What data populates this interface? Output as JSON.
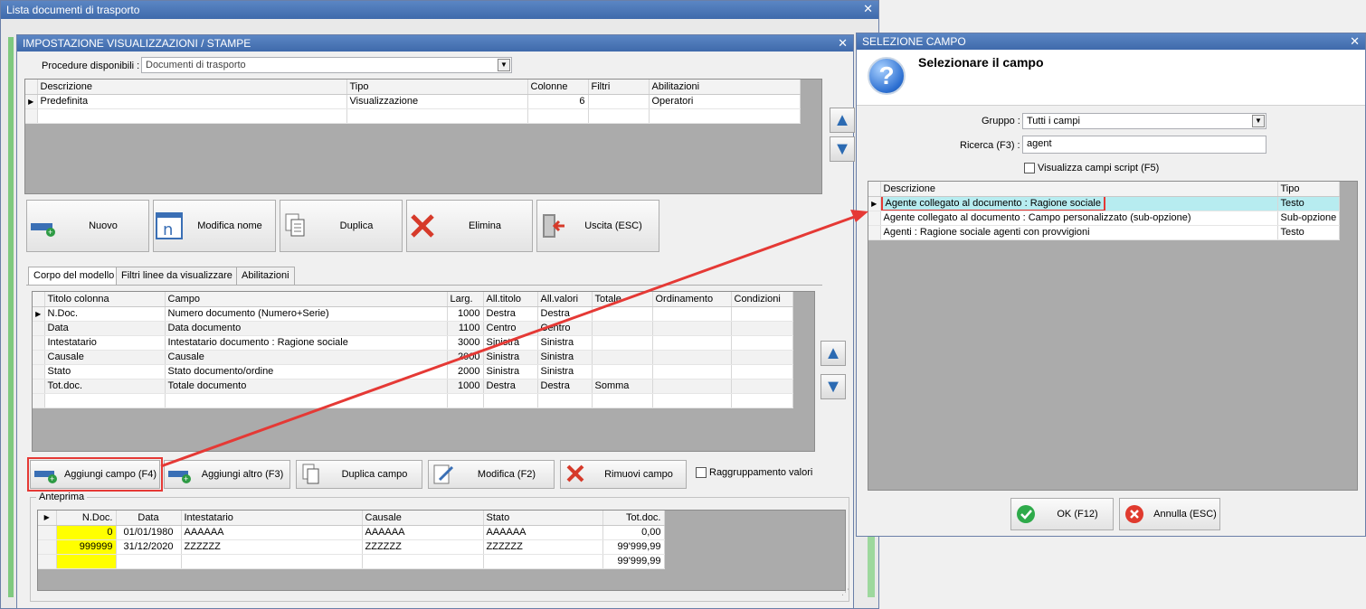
{
  "back_window": {
    "title": "Lista documenti di trasporto"
  },
  "impostazione": {
    "title": "IMPOSTAZIONE VISUALIZZAZIONI / STAMPE",
    "procedure_label": "Procedure disponibili :",
    "procedure_value": "Documenti di trasporto",
    "layouts_grid": {
      "headers": [
        "Descrizione",
        "Tipo",
        "Colonne",
        "Filtri",
        "Abilitazioni"
      ],
      "rows": [
        [
          "Predefinita",
          "Visualizzazione",
          "6",
          "",
          "Operatori"
        ]
      ]
    },
    "toolbar": {
      "nuovo": "Nuovo",
      "modifica_nome": "Modifica nome",
      "duplica": "Duplica",
      "elimina": "Elimina",
      "uscita": "Uscita (ESC)"
    },
    "tabs": [
      "Corpo del modello",
      "Filtri linee da visualizzare",
      "Abilitazioni"
    ],
    "columns_grid": {
      "headers": [
        "Titolo colonna",
        "Campo",
        "Larg.",
        "All.titolo",
        "All.valori",
        "Totale",
        "Ordinamento",
        "Condizioni"
      ],
      "rows": [
        [
          "N.Doc.",
          "Numero documento (Numero+Serie)",
          "1000",
          "Destra",
          "Destra",
          "",
          "",
          ""
        ],
        [
          "Data",
          "Data documento",
          "1100",
          "Centro",
          "Centro",
          "",
          "",
          ""
        ],
        [
          "Intestatario",
          "Intestatario documento : Ragione sociale",
          "3000",
          "Sinistra",
          "Sinistra",
          "",
          "",
          ""
        ],
        [
          "Causale",
          "Causale",
          "2000",
          "Sinistra",
          "Sinistra",
          "",
          "",
          ""
        ],
        [
          "Stato",
          "Stato documento/ordine",
          "2000",
          "Sinistra",
          "Sinistra",
          "",
          "",
          ""
        ],
        [
          "Tot.doc.",
          "Totale documento",
          "1000",
          "Destra",
          "Destra",
          "Somma",
          "",
          ""
        ]
      ]
    },
    "actions": {
      "aggiungi_campo": "Aggiungi campo (F4)",
      "aggiungi_altro": "Aggiungi altro (F3)",
      "duplica_campo": "Duplica campo",
      "modifica": "Modifica (F2)",
      "rimuovi": "Rimuovi campo",
      "raggruppamento": "Raggruppamento valori"
    },
    "anteprima": {
      "label": "Anteprima",
      "headers": [
        "N.Doc.",
        "Data",
        "Intestatario",
        "Causale",
        "Stato",
        "Tot.doc."
      ],
      "rows": [
        [
          "0",
          "01/01/1980",
          "AAAAAA",
          "AAAAAA",
          "AAAAAA",
          "0,00"
        ],
        [
          "999999",
          "31/12/2020",
          "ZZZZZZ",
          "ZZZZZZ",
          "ZZZZZZ",
          "99'999,99"
        ],
        [
          "",
          "",
          "",
          "",
          "",
          "99'999,99"
        ]
      ]
    }
  },
  "selezione": {
    "title": "SELEZIONE CAMPO",
    "heading": "Selezionare il campo",
    "gruppo_label": "Gruppo :",
    "gruppo_value": "Tutti i campi",
    "ricerca_label": "Ricerca (F3) :",
    "ricerca_value": "agent",
    "script_label": "Visualizza campi script (F5)",
    "grid": {
      "headers": [
        "Descrizione",
        "Tipo"
      ],
      "rows": [
        [
          "Agente collegato al documento : Ragione sociale",
          "Testo"
        ],
        [
          "Agente collegato al documento : Campo personalizzato (sub-opzione)",
          "Sub-opzione"
        ],
        [
          "Agenti : Ragione sociale agenti con provvigioni",
          "Testo"
        ]
      ]
    },
    "ok": "OK (F12)",
    "annulla": "Annulla (ESC)"
  },
  "colors": {
    "highlight": "#ff3b3b",
    "selected_row": "#b7ecf0",
    "yellow_cell": "#ffff00",
    "title_blue": "#4a74b4"
  }
}
